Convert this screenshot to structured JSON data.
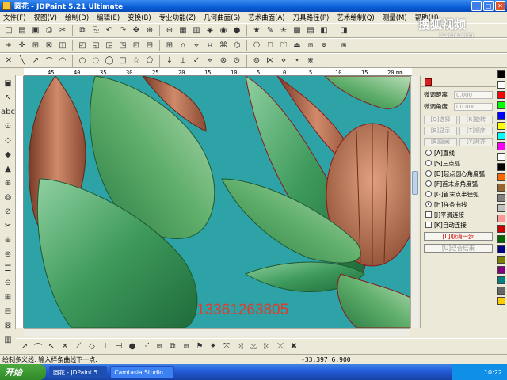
{
  "window": {
    "title": "圆花 - JDPaint 5.21 Ultimate"
  },
  "menu": [
    "文件(F)",
    "视图(V)",
    "绘制(D)",
    "编辑(E)",
    "变换(B)",
    "专业功能(Z)",
    "几何曲面(S)",
    "艺术曲面(A)",
    "刀具路径(P)",
    "艺术绘制(Q)",
    "测量(M)",
    "帮助(H)"
  ],
  "watermark": {
    "phone": "13361263805",
    "sohu": "搜狐视频",
    "url": "tv.sohu.com"
  },
  "ruler": {
    "labels": [
      "45",
      "40",
      "35",
      "30",
      "25",
      "20",
      "15",
      "10",
      "5",
      "0",
      "5",
      "10",
      "15",
      "20"
    ],
    "unit": "mm"
  },
  "panel": {
    "fields": [
      {
        "label": "微调距离",
        "value": "0.000"
      },
      {
        "label": "微调角度",
        "value": "00.000"
      }
    ],
    "grid_buttons": [
      "[Q]选择",
      "[R]旋转",
      "[B]显示",
      "[T]顺序",
      "[E]隐藏",
      "[Y]对齐"
    ],
    "radios": [
      {
        "label": "[A]直线",
        "on": false
      },
      {
        "label": "[S]三点弧",
        "on": false
      },
      {
        "label": "[D]起点圆心角度弧",
        "on": false
      },
      {
        "label": "[F]首末点角度弧",
        "on": false
      },
      {
        "label": "[G]首末点半径弧",
        "on": false
      },
      {
        "label": "[H]样条曲线",
        "on": true
      }
    ],
    "checks": [
      "[J]平滑连接",
      "[K]自动连接"
    ],
    "cancel_step": "[L]取消一步",
    "finish": "[U]结合结束"
  },
  "palette": [
    "#000000",
    "#ffffff",
    "#ff0000",
    "#00ff00",
    "#0000ff",
    "#ffff00",
    "#00ffff",
    "#ff00ff",
    "#ffffff",
    "#000000",
    "#ff6600",
    "#996633",
    "#808080",
    "#c0c0c0",
    "#ff9999",
    "#cc0000",
    "#006600",
    "#000080",
    "#808000",
    "#800080",
    "#008080",
    "#666666",
    "#ffcc00"
  ],
  "status": {
    "prompt": "绘制多义线: 输入样条曲线下一点:",
    "coord": "-33.397  6.900"
  },
  "taskbar": {
    "start": "开始",
    "tasks": [
      "圆花 - JDPaint 5...",
      "Camtasia Studio ..."
    ],
    "clock": "10:22"
  }
}
